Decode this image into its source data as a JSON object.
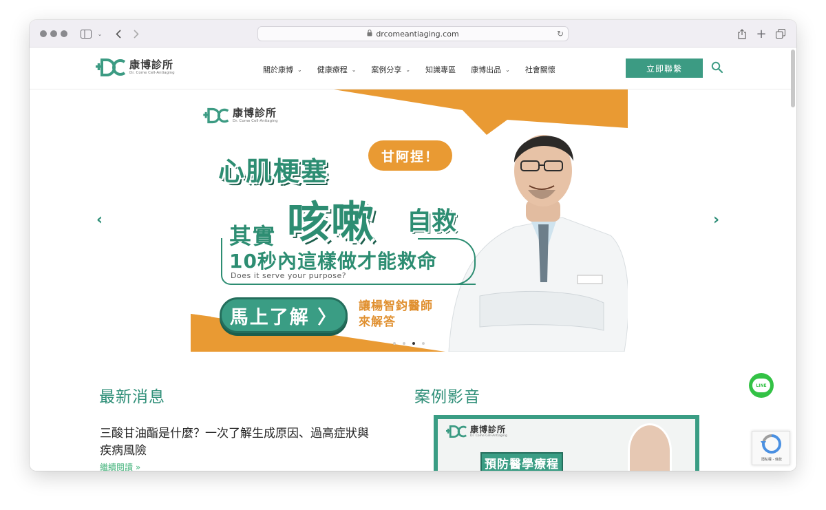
{
  "browser": {
    "url": "drcomeantiaging.com",
    "icons": [
      "traffic-lights",
      "sidebar-icon",
      "back-icon",
      "forward-icon",
      "lock-icon",
      "reload-icon",
      "share-icon",
      "new-tab-icon",
      "tabs-icon"
    ]
  },
  "site": {
    "logo_cn": "康博診所",
    "logo_en": "Dr. Come Cell-Antiaging",
    "brand_color": "#3c9b83",
    "accent_color": "#e99a33"
  },
  "nav": {
    "items": [
      {
        "label": "關於康博",
        "has_dropdown": true
      },
      {
        "label": "健康療程",
        "has_dropdown": true
      },
      {
        "label": "案例分享",
        "has_dropdown": true
      },
      {
        "label": "知識專區",
        "has_dropdown": false
      },
      {
        "label": "康博出品",
        "has_dropdown": true
      },
      {
        "label": "社會關懷",
        "has_dropdown": false
      }
    ],
    "contact_label": "立即聯繫"
  },
  "banner": {
    "logo_cn": "康博診所",
    "logo_en": "Dr. Come Cell-Antiaging",
    "bubble": "甘阿捏！",
    "line1": "心肌梗塞",
    "line2_big": "咳嗽",
    "line2_small": "自救",
    "prefix": "其實",
    "subtitle_cn": "10秒內這樣做才能救命",
    "subtitle_en": "Does it serve your purpose?",
    "cta": "馬上了解 〉",
    "answer_line1": "讓楊智鈞醫師",
    "answer_line2": "來解答",
    "slide_count": 4,
    "active_slide": 3
  },
  "news": {
    "section_title": "最新消息",
    "post_title": "三酸甘油酯是什麼？一次了解生成原因、過高症狀與疾病風險",
    "read_more": "繼續閱讀 »"
  },
  "videos": {
    "section_title": "案例影音",
    "card_logo_cn": "康博診所",
    "card_logo_en": "Dr. Come Cell-Antiaging",
    "card_tag": "預防醫學療程"
  },
  "widgets": {
    "line_label": "LINE",
    "recaptcha_label": "隱私權 - 條款"
  }
}
